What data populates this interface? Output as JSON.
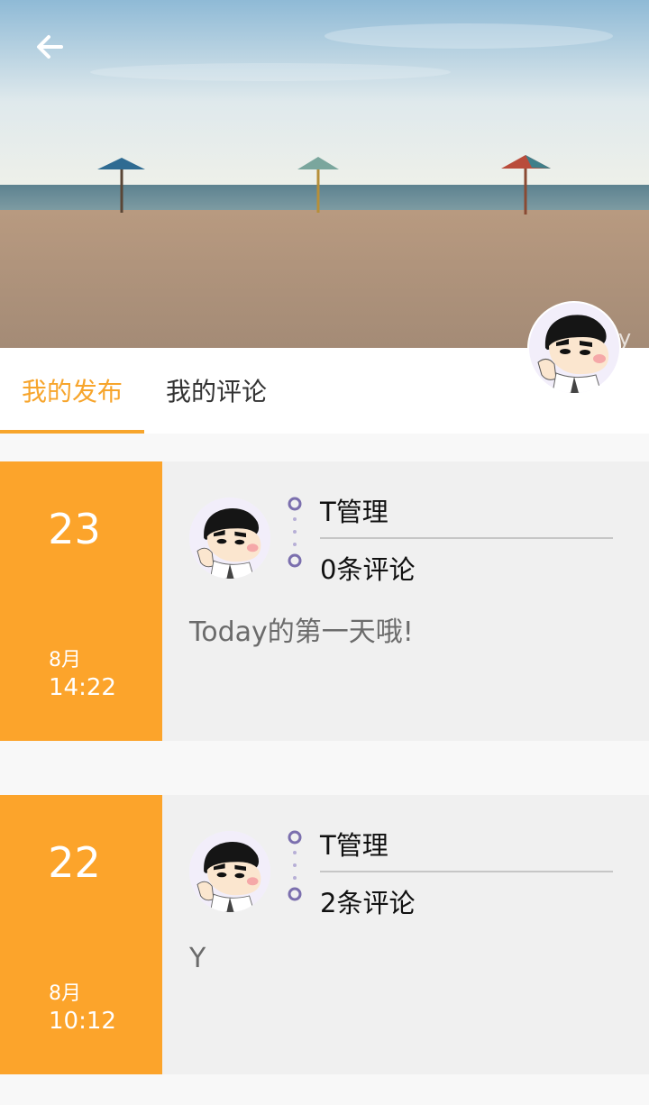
{
  "header": {
    "back_icon": "arrow-left-icon",
    "watermark_fragment": "y"
  },
  "tabs": [
    {
      "label": "我的发布",
      "active": true
    },
    {
      "label": "我的评论",
      "active": false
    }
  ],
  "profile": {
    "avatar": "cartoon-boy-avatar"
  },
  "posts": [
    {
      "day": "23",
      "month": "8月",
      "time": "14:22",
      "author": "T管理",
      "comments": "0条评论",
      "content": "Today的第一天哦!"
    },
    {
      "day": "22",
      "month": "8月",
      "time": "10:12",
      "author": "T管理",
      "comments": "2条评论",
      "content": "Y"
    }
  ],
  "colors": {
    "accent": "#fca42b",
    "tab_active": "#f7a52c",
    "timeline": "#7b6fae"
  }
}
